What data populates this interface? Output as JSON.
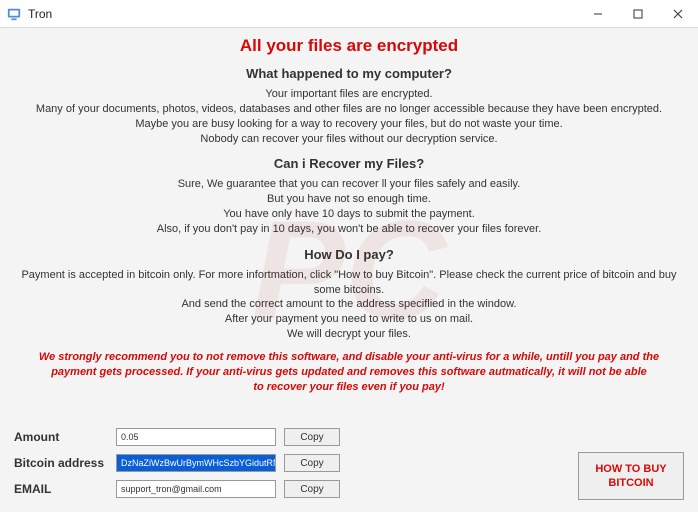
{
  "window": {
    "title": "Tron"
  },
  "headings": {
    "main": "All your files are encrypted",
    "h1": "What happened to my computer?",
    "h2": "Can i Recover my Files?",
    "h3": "How Do I pay?"
  },
  "section1": {
    "l1": "Your important files are encrypted.",
    "l2": "Many of your documents, photos, videos, databases and other files are no longer accessible because they have been encrypted.",
    "l3": "Maybe you are busy looking for a way to recovery your files, but do not waste your time.",
    "l4": "Nobody can recover your files without our decryption service."
  },
  "section2": {
    "l1": "Sure, We guarantee that you can recover ll your files safely and easily.",
    "l2": "But you have not so enough time.",
    "l3": "You have only have 10 days to submit the payment.",
    "l4": "Also, if you don't pay in 10 days, you won't be able to recover your files forever."
  },
  "section3": {
    "l1": "Payment is accepted in bitcoin only. For more infortmation, click \"How to buy Bitcoin\". Please check the current price of bitcoin and buy some bitcoins.",
    "l2": "And send the correct amount to the address speciflied in the window.",
    "l3": "After your payment you need to write to us on mail.",
    "l4": "We will decrypt your files."
  },
  "warning": {
    "l1": "We strongly recommend you to not remove this software, and disable your anti-virus for a while, untill you pay and the",
    "l2": "payment gets processed. If your anti-virus gets updated and removes this software autmatically, it will not be able",
    "l3": "to recover your files even if you pay!"
  },
  "fields": {
    "amount_label": "Amount",
    "amount_value": "0.05",
    "bitcoin_label": "Bitcoin address",
    "bitcoin_value": "DzNaZiWzBwUrBymWHcSzbYGidutRNDuEd",
    "email_label": "EMAIL",
    "email_value": "support_tron@gmail.com",
    "copy": "Copy"
  },
  "buy_button": "HOW TO BUY BITCOIN"
}
